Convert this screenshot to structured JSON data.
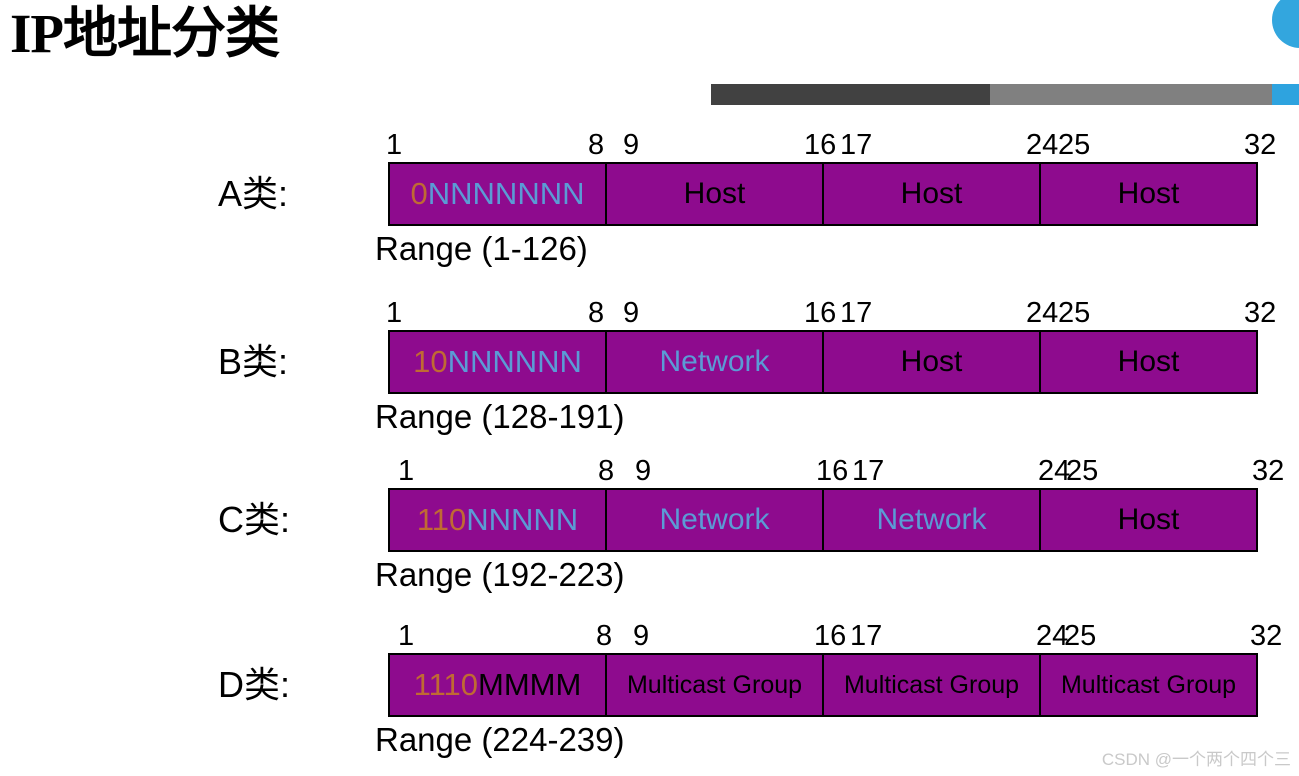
{
  "header": {
    "title": "IP地址分类",
    "deco_circle_color": "#33A6DE",
    "deco_bar": [
      {
        "name": "dark",
        "color": "#414141"
      },
      {
        "name": "gray",
        "color": "#808080"
      },
      {
        "name": "blue",
        "color": "#2EA3DF"
      }
    ]
  },
  "colors": {
    "block_bg": "#8E0B8E",
    "prefix_bits": "#C06A33",
    "network_bits": "#5B9BD5",
    "host_text": "#000000",
    "border": "#000000",
    "watermark": "#C9C9C9"
  },
  "bit_ticks": [
    "1",
    "8",
    "9",
    "16",
    "17",
    "24",
    "25",
    "32"
  ],
  "classes": [
    {
      "label": "A类:",
      "prefix": "0",
      "variable": "NNNNNNN",
      "variable_kind": "network",
      "octets": [
        "0NNNNNNN",
        "Host",
        "Host",
        "Host"
      ],
      "octet_kinds": [
        "pattern",
        "host",
        "host",
        "host"
      ],
      "range": "Range (1-126)"
    },
    {
      "label": "B类:",
      "prefix": "10",
      "variable": "NNNNNN",
      "variable_kind": "network",
      "octets": [
        "10NNNNNN",
        "Network",
        "Host",
        "Host"
      ],
      "octet_kinds": [
        "pattern",
        "network",
        "host",
        "host"
      ],
      "range": "Range (128-191)"
    },
    {
      "label": "C类:",
      "prefix": "110",
      "variable": "NNNNN",
      "variable_kind": "network",
      "octets": [
        "110NNNNN",
        "Network",
        "Network",
        "Host"
      ],
      "octet_kinds": [
        "pattern",
        "network",
        "network",
        "host"
      ],
      "range": "Range (192-223)"
    },
    {
      "label": "D类:",
      "prefix": "1110",
      "variable": "MMMM",
      "variable_kind": "mcast",
      "octets": [
        "1110MMMM",
        "Multicast Group",
        "Multicast Group",
        "Multicast Group"
      ],
      "octet_kinds": [
        "pattern",
        "mcast",
        "mcast",
        "mcast"
      ],
      "range": "Range (224-239)"
    }
  ],
  "watermark": "CSDN @一个两个四个三"
}
